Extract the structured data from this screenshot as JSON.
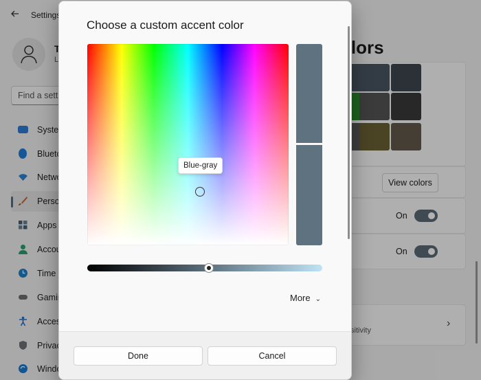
{
  "window": {
    "title": "Settings"
  },
  "user": {
    "name": "T",
    "subtitle": "L"
  },
  "search": {
    "placeholder": "Find a setti"
  },
  "sidebar": {
    "items": [
      {
        "label": "Syster",
        "icon": "monitor-icon",
        "color": "#2d7bd5"
      },
      {
        "label": "Blueto",
        "icon": "bluetooth-icon",
        "color": "#1e7cd8"
      },
      {
        "label": "Netwo",
        "icon": "wifi-icon",
        "color": "#2a86d9"
      },
      {
        "label": "Perso",
        "icon": "paintbrush-icon",
        "color": "#d26a2a"
      },
      {
        "label": "Apps",
        "icon": "apps-icon",
        "color": "#4a5f75"
      },
      {
        "label": "Accou",
        "icon": "person-icon",
        "color": "#2aa06f"
      },
      {
        "label": "Time",
        "icon": "clock-icon",
        "color": "#1f7fc7"
      },
      {
        "label": "Gamin",
        "icon": "gamepad-icon",
        "color": "#707070"
      },
      {
        "label": "Acces",
        "icon": "accessibility-icon",
        "color": "#1a6fd0"
      },
      {
        "label": "Privac",
        "icon": "shield-icon",
        "color": "#6f7378"
      },
      {
        "label": "Windo",
        "icon": "windows-update-icon",
        "color": "#1a7ad4"
      }
    ]
  },
  "page": {
    "title": "olors"
  },
  "swatches": [
    "#4a5663",
    "#3f4750",
    "#2a8c2a",
    "#555555",
    "#3a3a3a",
    "#5a5a5a",
    "#6b6034",
    "#625a4d"
  ],
  "view_colors_label": "View colors",
  "toggles": [
    {
      "state": "On"
    },
    {
      "state": "On"
    }
  ],
  "sensitivity_text": "sitivity",
  "dialog": {
    "title": "Choose a custom accent color",
    "tooltip": "Blue-gray",
    "selected_color": "#5e7280",
    "more_label": "More",
    "done_label": "Done",
    "cancel_label": "Cancel"
  }
}
